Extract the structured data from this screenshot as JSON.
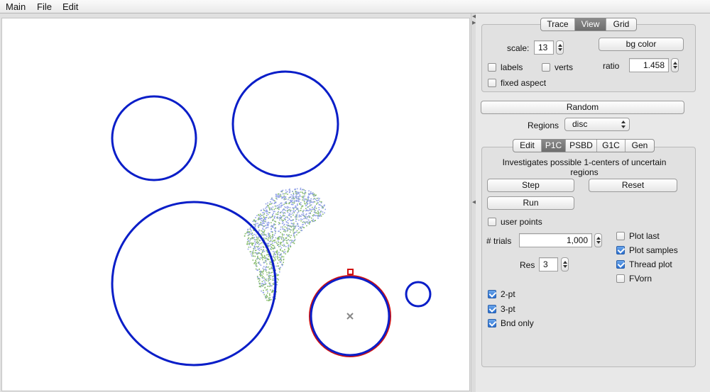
{
  "menubar": {
    "items": [
      "Main",
      "File",
      "Edit"
    ]
  },
  "canvas": {
    "region_color": "#0a1ec8",
    "selected_circle_color": "#d01010",
    "sample_colors": [
      "#8fa0e6",
      "#86bb6c"
    ],
    "center_marker": "x-icon"
  },
  "view_panel": {
    "tabs": [
      "Trace",
      "View",
      "Grid"
    ],
    "selected_tab": "View",
    "scale_label": "scale:",
    "scale_value": "13",
    "bg_color_label": "bg color",
    "labels_label": "labels",
    "labels_checked": false,
    "verts_label": "verts",
    "verts_checked": false,
    "ratio_label": "ratio",
    "ratio_value": "1.458",
    "fixed_aspect_label": "fixed aspect",
    "fixed_aspect_checked": false
  },
  "random_button": "Random",
  "regions": {
    "label": "Regions",
    "value": "disc"
  },
  "tool_panel": {
    "tabs": [
      "Edit",
      "P1C",
      "PSBD",
      "G1C",
      "Gen"
    ],
    "selected_tab": "P1C",
    "description": "Investigates possible 1-centers of uncertain regions",
    "step_label": "Step",
    "reset_label": "Reset",
    "run_label": "Run",
    "user_points_label": "user points",
    "user_points_checked": false,
    "trials_label": "# trials",
    "trials_value": "1,000",
    "res_label": "Res",
    "res_value": "3",
    "plot_last_label": "Plot last",
    "plot_last_checked": false,
    "plot_samples_label": "Plot samples",
    "plot_samples_checked": true,
    "thread_plot_label": "Thread plot",
    "thread_plot_checked": true,
    "fvorn_label": "FVorn",
    "fvorn_checked": false,
    "two_pt_label": "2-pt",
    "two_pt_checked": true,
    "three_pt_label": "3-pt",
    "three_pt_checked": true,
    "bnd_only_label": "Bnd only",
    "bnd_only_checked": true
  }
}
